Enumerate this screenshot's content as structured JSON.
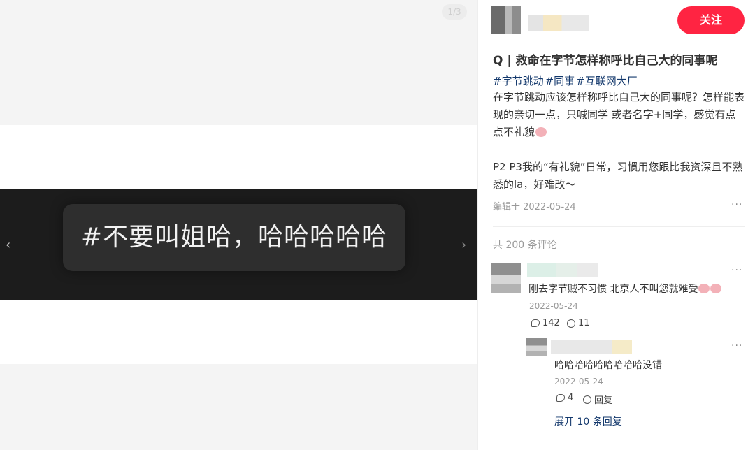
{
  "media": {
    "counter": "1/3",
    "image_text": "#不要叫姐哈，哈哈哈哈哈"
  },
  "post": {
    "follow_label": "关注",
    "title": "Q | 救命在字节怎样称呼比自己大的同事呢",
    "tags": [
      "#字节跳动",
      "#同事",
      "#互联网大厂"
    ],
    "desc_line1": "在字节跳动应该怎样称呼比自己大的同事呢？怎样能表现的亲切一点，只喊同学 或者名字+同学，感觉有点点不礼貌",
    "desc_line2": "P2 P3我的“有礼貌”日常，习惯用您跟比我资深且不熟悉的la，好难改～",
    "meta": "编辑于 2022-05-24",
    "more": "···"
  },
  "comments_header": "共 200 条评论",
  "comments": [
    {
      "text": "刚去字节贼不习惯 北京人不叫您就难受",
      "date": "2022-05-24",
      "likes": "142",
      "replies": "11",
      "more": "···"
    }
  ],
  "reply": {
    "text": "哈哈哈哈哈哈哈哈哈没错",
    "date": "2022-05-24",
    "likes": "4",
    "reply_label": "回复",
    "more": "···"
  },
  "expand_label": "展开 10 条回复",
  "colors": {
    "accent": "#ff2442",
    "link": "#13386c"
  }
}
